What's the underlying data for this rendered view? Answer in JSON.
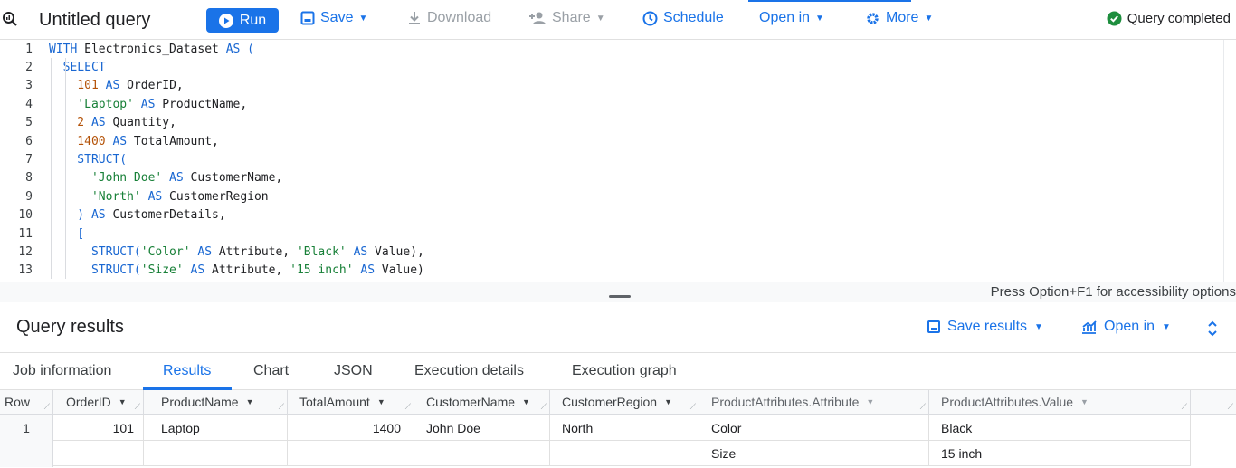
{
  "toolbar": {
    "title": "Untitled query",
    "run": "Run",
    "save": "Save",
    "download": "Download",
    "share": "Share",
    "schedule": "Schedule",
    "open_in": "Open in",
    "more": "More",
    "status": "Query completed",
    "accent": "#1a73e8",
    "success": "#1e8e3e"
  },
  "editor": {
    "line_numbers": [
      "1",
      "2",
      "3",
      "4",
      "5",
      "6",
      "7",
      "8",
      "9",
      "10",
      "11",
      "12",
      "13"
    ],
    "lines": [
      [
        {
          "t": "WITH",
          "c": "kw"
        },
        {
          "t": " Electronics_Dataset ",
          "c": ""
        },
        {
          "t": "AS (",
          "c": "kw"
        }
      ],
      [
        {
          "t": "  SELECT",
          "c": "kw"
        }
      ],
      [
        {
          "t": "    101",
          "c": "num"
        },
        {
          "t": " AS",
          "c": "kw"
        },
        {
          "t": " OrderID,",
          "c": ""
        }
      ],
      [
        {
          "t": "    'Laptop'",
          "c": "str"
        },
        {
          "t": " AS",
          "c": "kw"
        },
        {
          "t": " ProductName,",
          "c": ""
        }
      ],
      [
        {
          "t": "    2",
          "c": "num"
        },
        {
          "t": " AS",
          "c": "kw"
        },
        {
          "t": " Quantity,",
          "c": ""
        }
      ],
      [
        {
          "t": "    1400",
          "c": "num"
        },
        {
          "t": " AS",
          "c": "kw"
        },
        {
          "t": " TotalAmount,",
          "c": ""
        }
      ],
      [
        {
          "t": "    STRUCT(",
          "c": "kw"
        }
      ],
      [
        {
          "t": "      'John Doe'",
          "c": "str"
        },
        {
          "t": " AS",
          "c": "kw"
        },
        {
          "t": " CustomerName,",
          "c": ""
        }
      ],
      [
        {
          "t": "      'North'",
          "c": "str"
        },
        {
          "t": " AS",
          "c": "kw"
        },
        {
          "t": " CustomerRegion",
          "c": ""
        }
      ],
      [
        {
          "t": "    ) ",
          "c": "kw"
        },
        {
          "t": "AS",
          "c": "kw"
        },
        {
          "t": " CustomerDetails,",
          "c": ""
        }
      ],
      [
        {
          "t": "    [",
          "c": "kw"
        }
      ],
      [
        {
          "t": "      STRUCT(",
          "c": "kw"
        },
        {
          "t": "'Color'",
          "c": "str"
        },
        {
          "t": " AS",
          "c": "kw"
        },
        {
          "t": " Attribute, ",
          "c": ""
        },
        {
          "t": "'Black'",
          "c": "str"
        },
        {
          "t": " AS",
          "c": "kw"
        },
        {
          "t": " Value),",
          "c": ""
        }
      ],
      [
        {
          "t": "      STRUCT(",
          "c": "kw"
        },
        {
          "t": "'Size'",
          "c": "str"
        },
        {
          "t": " AS",
          "c": "kw"
        },
        {
          "t": " Attribute, ",
          "c": ""
        },
        {
          "t": "'15 inch'",
          "c": "str"
        },
        {
          "t": " AS",
          "c": "kw"
        },
        {
          "t": " Value)",
          "c": ""
        }
      ]
    ],
    "accessibility_hint": "Press Option+F1 for accessibility options"
  },
  "results": {
    "title": "Query results",
    "save_results": "Save results",
    "open_in": "Open in",
    "tabs": [
      "Job information",
      "Results",
      "Chart",
      "JSON",
      "Execution details",
      "Execution graph"
    ],
    "active_tab": "Results",
    "columns": [
      "Row",
      "OrderID",
      "ProductName",
      "TotalAmount",
      "CustomerName",
      "CustomerRegion",
      "ProductAttributes.Attribute",
      "ProductAttributes.Value"
    ],
    "rows": [
      {
        "row": "1",
        "OrderID": "101",
        "ProductName": "Laptop",
        "TotalAmount": "1400",
        "CustomerName": "John Doe",
        "CustomerRegion": "North",
        "attributes": [
          {
            "Attribute": "Color",
            "Value": "Black"
          },
          {
            "Attribute": "Size",
            "Value": "15 inch"
          }
        ]
      }
    ]
  }
}
